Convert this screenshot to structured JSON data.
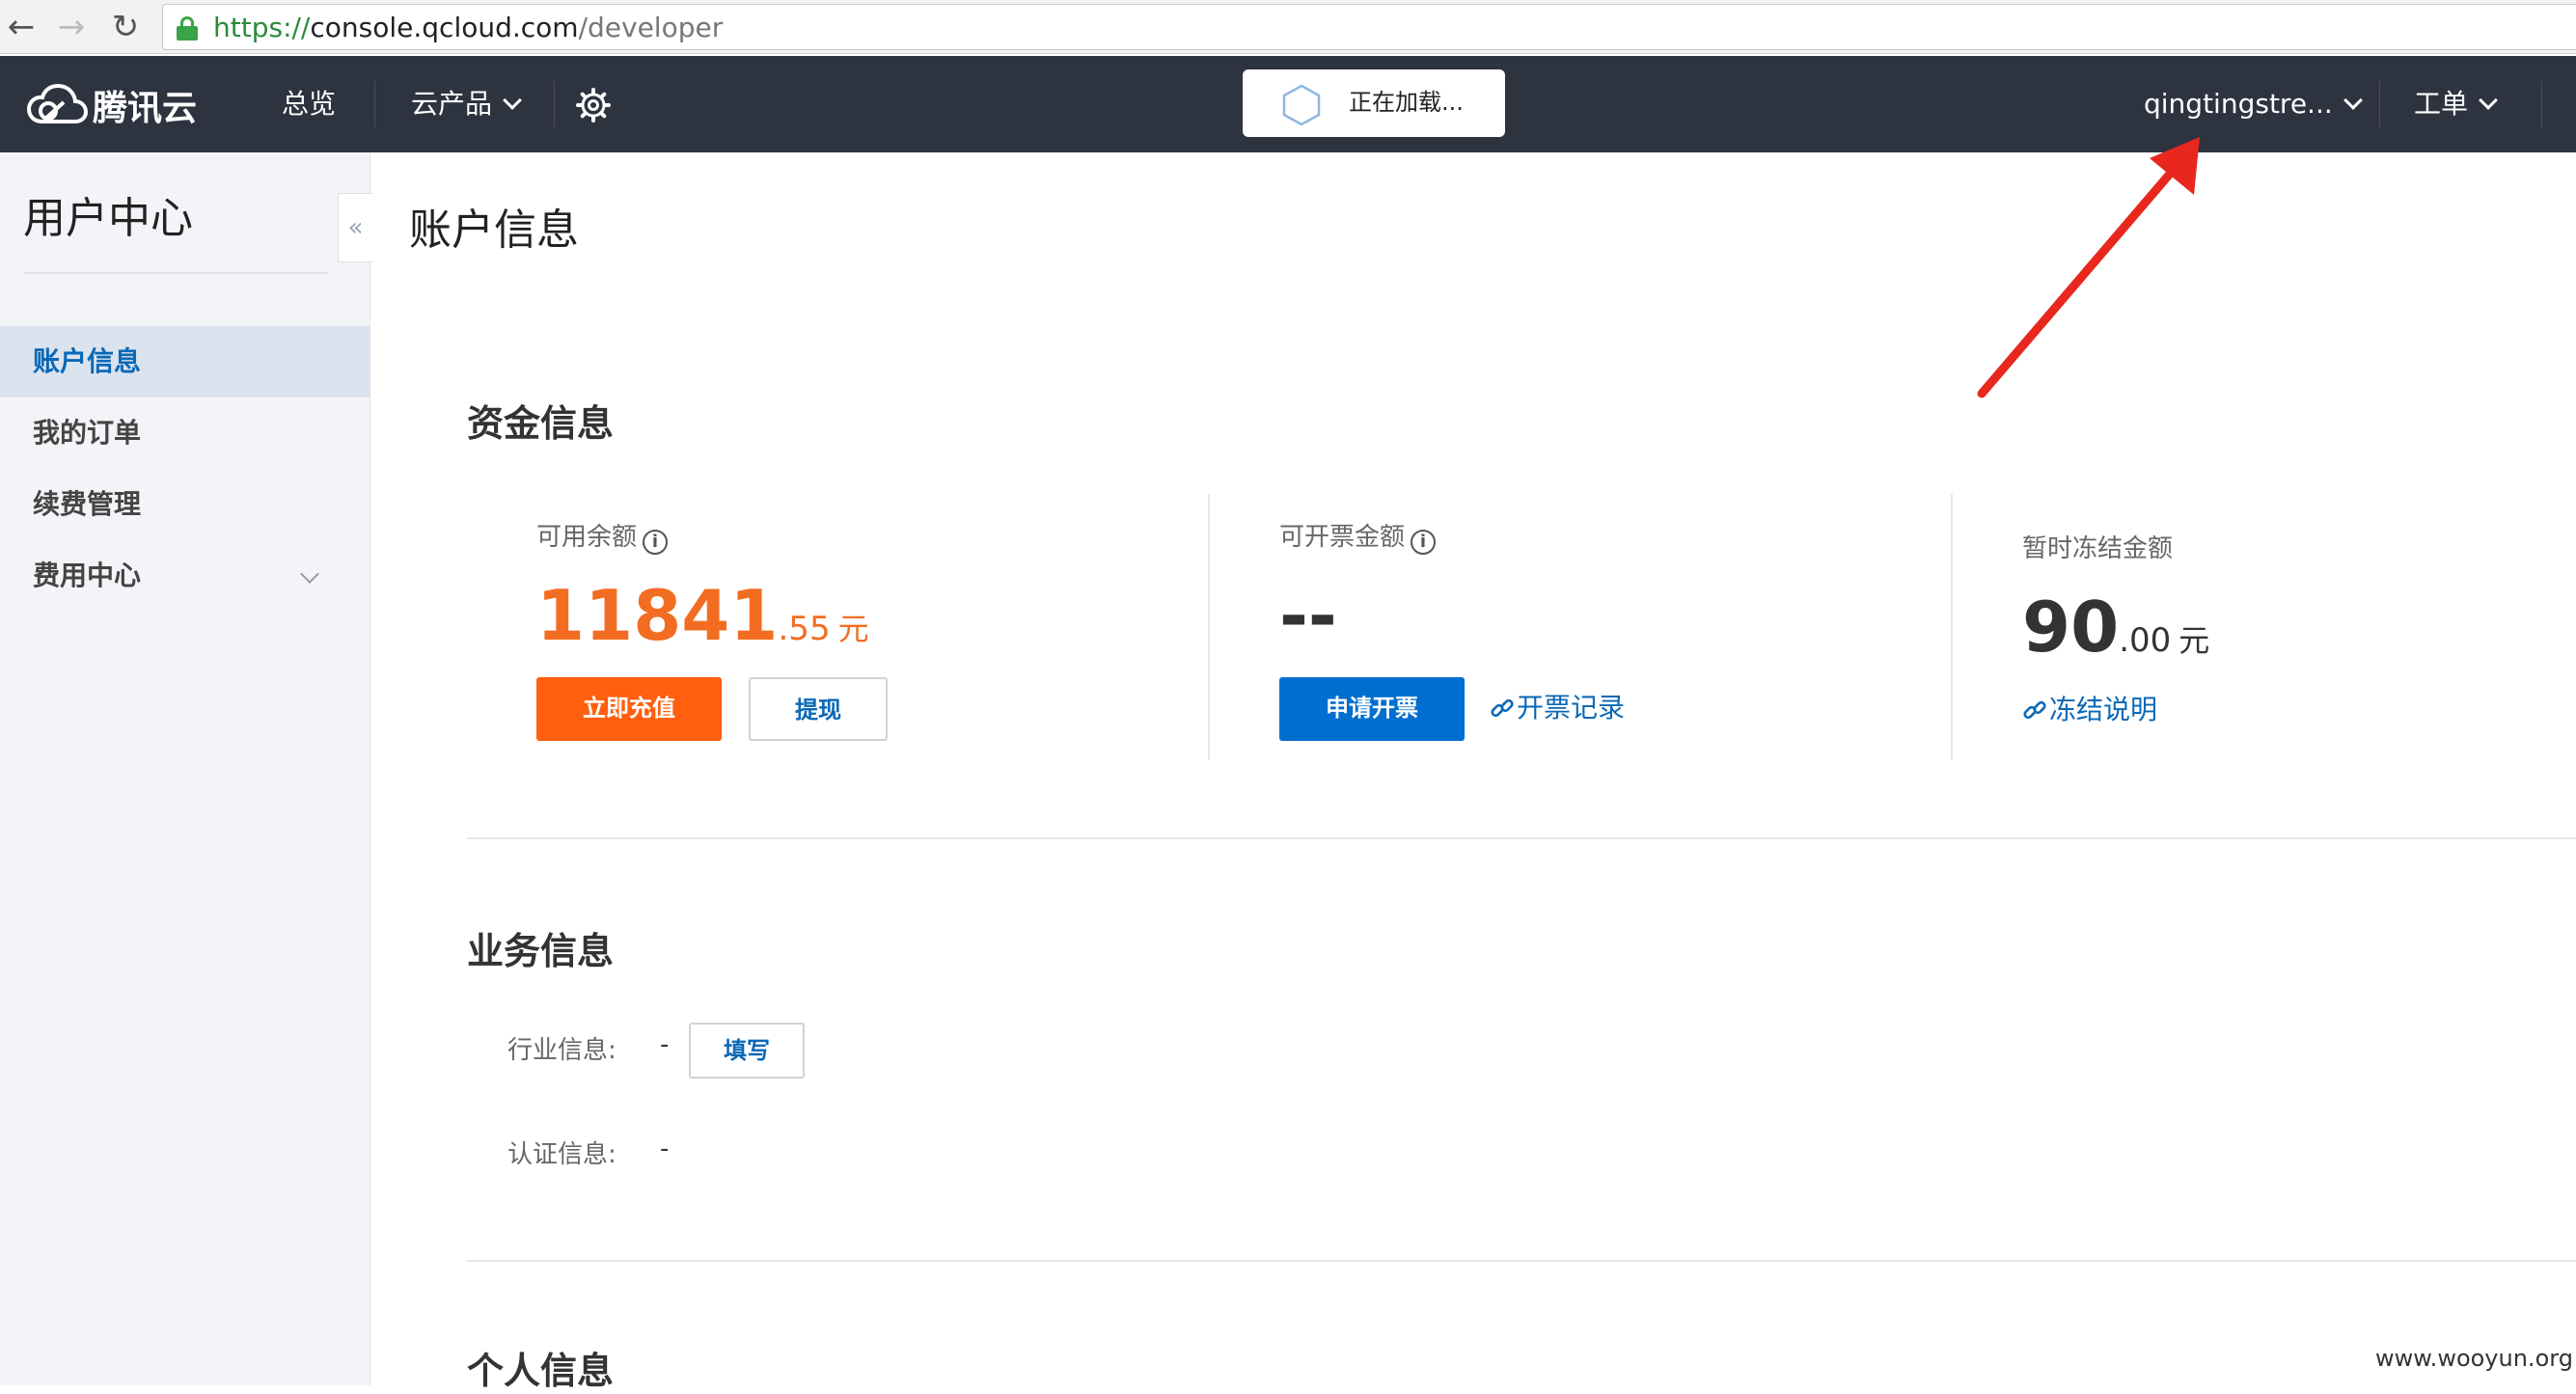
{
  "browser": {
    "url_scheme": "https://",
    "url_host": "console.qcloud.com",
    "url_path": "/developer"
  },
  "topnav": {
    "logo": "腾讯云",
    "overview": "总览",
    "products": "云产品",
    "loading": "正在加载...",
    "user": "qingtingstre...",
    "ticket": "工单"
  },
  "sidebar": {
    "title": "用户中心",
    "collapse": "«",
    "items": [
      {
        "label": "账户信息"
      },
      {
        "label": "我的订单"
      },
      {
        "label": "续费管理"
      },
      {
        "label": "费用中心"
      }
    ]
  },
  "main": {
    "title": "账户信息",
    "fund": {
      "title": "资金信息",
      "balance": {
        "label": "可用余额",
        "int": "11841",
        "dec": ".55",
        "unit": "元",
        "recharge": "立即充值",
        "withdraw": "提现"
      },
      "invoice": {
        "label": "可开票金额",
        "value": "--",
        "apply": "申请开票",
        "records": "开票记录"
      },
      "frozen": {
        "label": "暂时冻结金额",
        "int": "90",
        "dec": ".00",
        "unit": "元",
        "explain": "冻结说明"
      }
    },
    "business": {
      "title": "业务信息",
      "industry_label": "行业信息:",
      "industry_value": "-",
      "fill": "填写",
      "cert_label": "认证信息:",
      "cert_value": "-"
    },
    "personal": {
      "title": "个人信息"
    }
  },
  "watermark": "www.wooyun.org",
  "colors": {
    "nav_bg": "#2e3340",
    "accent_orange": "#ff5f0f",
    "accent_blue": "#006ecf",
    "link_blue": "#0a68b6",
    "annotation_red": "#e8271f"
  }
}
